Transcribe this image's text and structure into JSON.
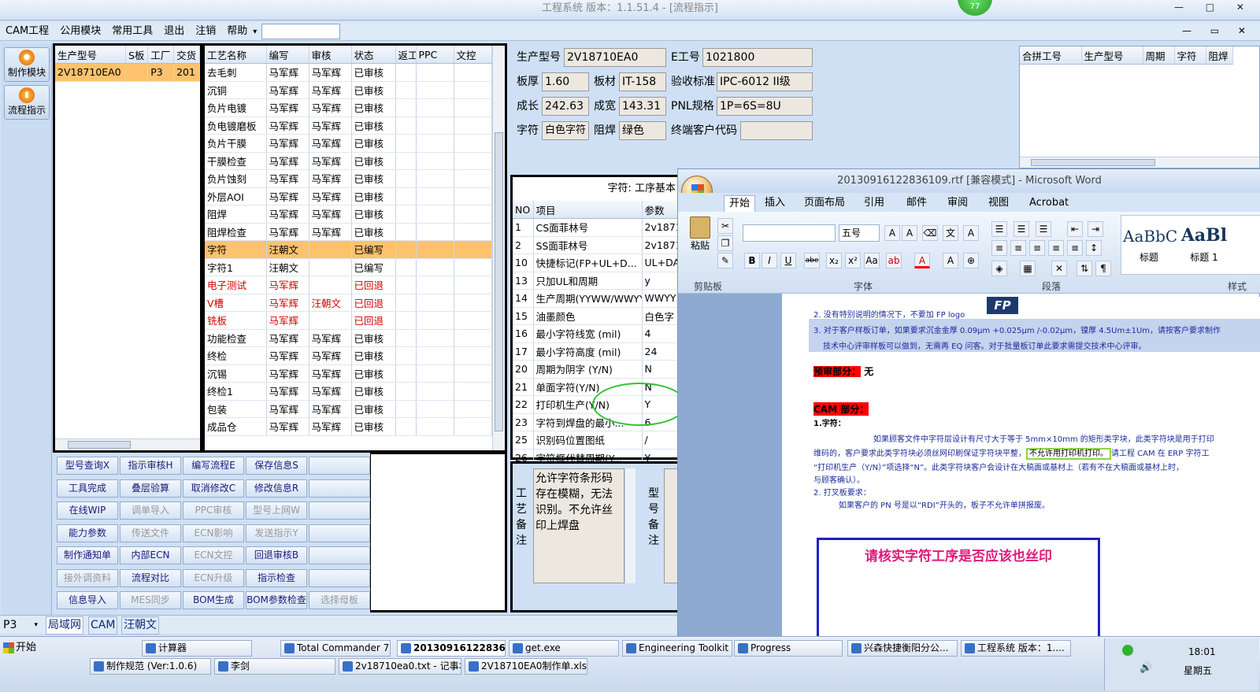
{
  "window": {
    "title": "工程系统  版本：1.1.51.4 - [流程指示]",
    "badge": "77",
    "controls": "— □ ✕",
    "mdi_controls": "— ▭ ✕"
  },
  "menu": [
    "CAM工程",
    "公用模块",
    "常用工具",
    "退出",
    "注销",
    "帮助"
  ],
  "menu_arrow": "▾",
  "left_buttons": [
    {
      "label": "制作模块"
    },
    {
      "label": "流程指示"
    }
  ],
  "left_table": {
    "headers": [
      "生产型号",
      "S板",
      "工厂",
      "交货"
    ],
    "rows": [
      [
        "2V18710EA0",
        "",
        "P3",
        "201"
      ]
    ]
  },
  "process_table": {
    "headers": [
      "工艺名称",
      "编写",
      "审核",
      "状态",
      "返工",
      "PPC",
      "文控"
    ],
    "rows": [
      {
        "c": [
          "去毛刺",
          "马军辉",
          "马军辉",
          "已审核"
        ]
      },
      {
        "c": [
          "沉铜",
          "马军辉",
          "马军辉",
          "已审核"
        ]
      },
      {
        "c": [
          "负片电镀",
          "马军辉",
          "马军辉",
          "已审核"
        ]
      },
      {
        "c": [
          "负电镀磨板",
          "马军辉",
          "马军辉",
          "已审核"
        ]
      },
      {
        "c": [
          "负片干膜",
          "马军辉",
          "马军辉",
          "已审核"
        ]
      },
      {
        "c": [
          "干膜检查",
          "马军辉",
          "马军辉",
          "已审核"
        ]
      },
      {
        "c": [
          "负片蚀刻",
          "马军辉",
          "马军辉",
          "已审核"
        ]
      },
      {
        "c": [
          "外层AOI",
          "马军辉",
          "马军辉",
          "已审核"
        ]
      },
      {
        "c": [
          "阻焊",
          "马军辉",
          "马军辉",
          "已审核"
        ]
      },
      {
        "c": [
          "阻焊检查",
          "马军辉",
          "马军辉",
          "已审核"
        ]
      },
      {
        "c": [
          "字符",
          "汪朝文",
          "",
          "已编写"
        ],
        "sel": true
      },
      {
        "c": [
          "字符1",
          "汪朝文",
          "",
          "已编写"
        ]
      },
      {
        "c": [
          "电子测试",
          "马军辉",
          "",
          "已回退"
        ],
        "red": true
      },
      {
        "c": [
          "V槽",
          "马军辉",
          "汪朝文",
          "已回退"
        ],
        "red": true
      },
      {
        "c": [
          "铣板",
          "马军辉",
          "",
          "已回退"
        ],
        "red": true
      },
      {
        "c": [
          "功能检查",
          "马军辉",
          "马军辉",
          "已审核"
        ]
      },
      {
        "c": [
          "终检",
          "马军辉",
          "马军辉",
          "已审核"
        ]
      },
      {
        "c": [
          "沉锡",
          "马军辉",
          "马军辉",
          "已审核"
        ]
      },
      {
        "c": [
          "终检1",
          "马军辉",
          "马军辉",
          "已审核"
        ]
      },
      {
        "c": [
          "包装",
          "马军辉",
          "马军辉",
          "已审核"
        ]
      },
      {
        "c": [
          "成品仓",
          "马军辉",
          "马军辉",
          "已审核"
        ]
      }
    ]
  },
  "buttons": [
    [
      "型号查询X",
      "指示审核H",
      "编写流程E",
      "保存信息S",
      ""
    ],
    [
      "工具完成",
      "叠层验算",
      "取消修改C",
      "修改信息R",
      ""
    ],
    [
      "在线WIP",
      "调单导入",
      "PPC审核",
      "型号上网W",
      ""
    ],
    [
      "能力参数",
      "传送文件",
      "ECN影响",
      "发送指示Y",
      ""
    ],
    [
      "制作通知单",
      "内部ECN",
      "ECN文控",
      "回退审核B",
      ""
    ],
    [
      "接外调资料",
      "流程对比",
      "ECN升级",
      "指示检查",
      ""
    ],
    [
      "信息导入",
      "MES同步",
      "BOM生成",
      "BOM参数检查",
      "选择母板"
    ]
  ],
  "disabled_buttons": [
    "调单导入",
    "PPC审核",
    "型号上网W",
    "传送文件",
    "ECN影响",
    "发送指示Y",
    "ECN文控",
    "接外调资料",
    "ECN升级",
    "MES同步",
    "选择母板"
  ],
  "info": {
    "labels": {
      "model": "生产型号",
      "e_no": "E工号",
      "thickness": "板厚",
      "material": "板材",
      "standard": "验收标准",
      "length": "成长",
      "width": "成宽",
      "pnl": "PNL规格",
      "char": "字符",
      "mask": "阻焊",
      "customer": "终端客户代码"
    },
    "values": {
      "model": "2V18710EA0",
      "e_no": "1021800",
      "thickness": "1.60",
      "material": "IT-158",
      "standard": "IPC-6012 II级",
      "length": "242.63",
      "width": "143.31",
      "pnl": "1P=6S=8U",
      "char": "白色字符",
      "mask": "绿色",
      "customer": ""
    }
  },
  "merge_table": {
    "headers": [
      "合拼工号",
      "生产型号",
      "周期",
      "字符",
      "阻焊"
    ]
  },
  "param_table": {
    "title": "字符: 工序基本",
    "headers": [
      "NO",
      "项目",
      "参数"
    ],
    "rows": [
      [
        "1",
        "CS面菲林号",
        "2v1871"
      ],
      [
        "2",
        "SS面菲林号",
        "2v1871"
      ],
      [
        "10",
        "快捷标记(FP+UL+D...",
        "UL+DA"
      ],
      [
        "13",
        "只加UL和周期",
        "y"
      ],
      [
        "14",
        "生产周期(YYWW/WWYY)",
        "WWYY"
      ],
      [
        "15",
        "油墨颜色",
        "白色字"
      ],
      [
        "16",
        "最小字符线宽 (mil)",
        "4"
      ],
      [
        "17",
        "最小字符高度 (mil)",
        "24"
      ],
      [
        "20",
        "周期为阴字 (Y/N)",
        "N"
      ],
      [
        "21",
        "单面字符(Y/N)",
        "N"
      ],
      [
        "22",
        "打印机生产(Y/N)",
        "Y"
      ],
      [
        "23",
        "字符到焊盘的最小...",
        "6"
      ],
      [
        "25",
        "识别码位置图纸",
        "/"
      ],
      [
        "26",
        "字符框代替周期(Y...",
        "Y"
      ]
    ]
  },
  "remarks": {
    "process_label": "工艺备注",
    "text": "允许字符条形码存在模糊，无法识别。不允许丝印上焊盘",
    "model_label": "型号备注"
  },
  "status_bar": {
    "combo": "P3",
    "tabs": [
      "局域网",
      "CAM",
      "汪朝文"
    ]
  },
  "word": {
    "title": "20130916122836109.rtf [兼容模式] - Microsoft Word",
    "tabs": [
      "开始",
      "插入",
      "页面布局",
      "引用",
      "邮件",
      "审阅",
      "视图",
      "Acrobat"
    ],
    "groups": [
      "剪贴板",
      "字体",
      "段落",
      "样式"
    ],
    "paste": "粘贴",
    "fontsize": "五号",
    "styles": [
      {
        "preview": "AaBbC",
        "name": "标题"
      },
      {
        "preview": "AaBl",
        "name": "标题 1"
      }
    ],
    "fmt": [
      "B",
      "I",
      "U",
      "abe",
      "x₂",
      "x²",
      "Aa"
    ],
    "doc": {
      "l1": "2. 没有特别说明的情况下，不要加 FP logo",
      "l2": "3. 对于客户样板订单，如果要求沉金金厚 0.09μm +0.025μm /-0.02μm，镍厚 4.5Um±1Um，请按客户要求制作",
      "l3": "技术中心评审样板可以做到，无需再 EQ 问客。对于批量板订单此要求需提交技术中心评审。",
      "pre_review": "预审部分：",
      "pre_val": "无",
      "cam": "CAM 部分：",
      "s1": "1.字符：",
      "p1": "如果顾客文件中字符层设计有尺寸大于等于 5mm×10mm 的矩形类字块，此类字符块是用于打印",
      "p2": "维码的，客户要求此类字符块必须丝网印刷保证字符块平整，",
      "p2b": "不允许用打印机打印。",
      "p2c": "请工程 CAM 在 ERP 字符工",
      "p3": "“打印机生产（Y/N）”项选择“N”。此类字符块客户会设计在大稿面或基材上（若有不在大稿面或基材上时，",
      "p4": "与顾客确认）。",
      "s2": "2. 打叉板要求：",
      "p5": "如果客户的 PN 号是以“RDI”开头的，板子不允许单拼报废。",
      "note": "请核实字符工序是否应该也丝印"
    }
  },
  "taskbar": {
    "start": "开始",
    "row1": [
      "计算器",
      "Total Commander 7.0...",
      "20130916122836I...",
      "get.exe",
      "Engineering Toolkit 9....",
      "Progress",
      "兴森快捷衡阳分公...",
      "工程系统  版本：1...."
    ],
    "row2": [
      "制作规范 (Ver:1.0.6)",
      "李剑",
      "2v18710ea0.txt - 记事本",
      "2V18710EA0制作单.xls ..."
    ],
    "time": "18:01",
    "day": "星期五"
  },
  "colors": {
    "selected_row": "#fcc26e",
    "returned": "#d40000",
    "highlight_red": "#ff0000",
    "note_border": "#1f1fc8",
    "note_text": "#e0197a"
  }
}
